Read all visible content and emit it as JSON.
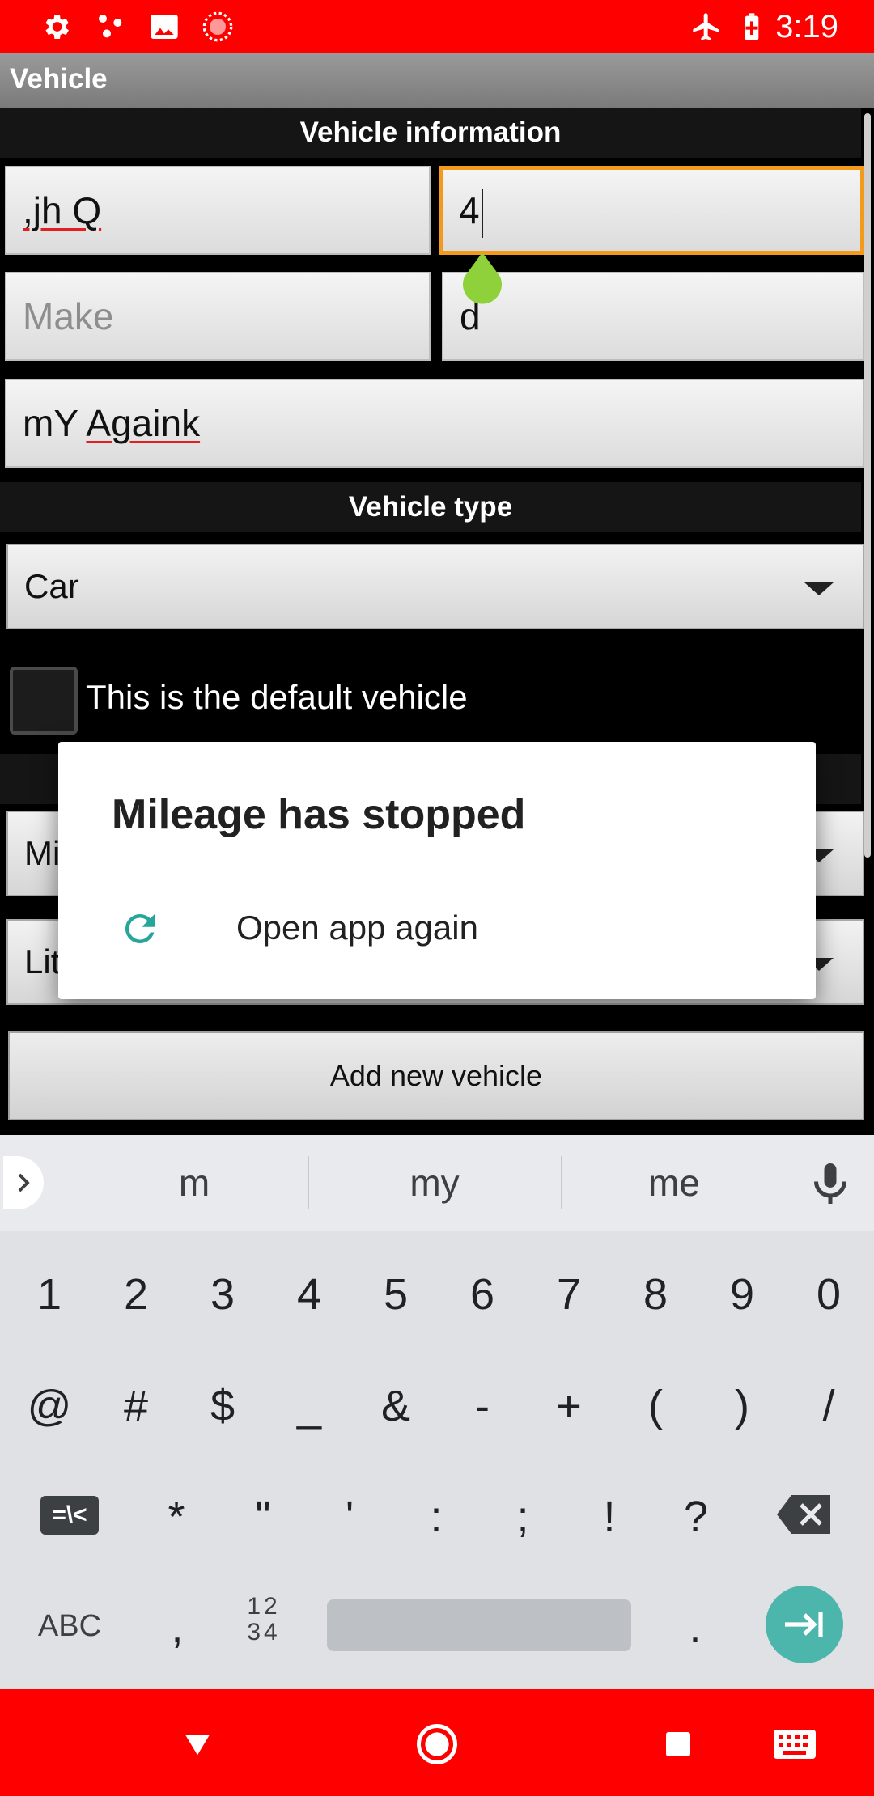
{
  "status_bar": {
    "time": "3:19",
    "icons": [
      "settings-icon",
      "network-dots-icon",
      "image-icon",
      "record-icon",
      "airplane-mode-icon",
      "battery-charging-icon"
    ]
  },
  "app": {
    "title": "Vehicle"
  },
  "vehicle_info": {
    "header": "Vehicle information",
    "name_value": ",jh Q",
    "year_value": "4",
    "make_placeholder": "Make",
    "model_value": "d",
    "note_value_prefix": "mY ",
    "note_value_underlined": "Againk"
  },
  "vehicle_type": {
    "header": "Vehicle type",
    "selected": "Car"
  },
  "default_checkbox": {
    "label": "This is the default vehicle",
    "checked": false
  },
  "units": {
    "distance_partial": "Mi",
    "volume_partial": "Lit"
  },
  "add_button_label": "Add new vehicle",
  "dialog": {
    "title": "Mileage has stopped",
    "action_label": "Open app again",
    "action_icon": "refresh-icon",
    "accent_color": "#26a69a"
  },
  "keyboard": {
    "suggestions": [
      "m",
      "my",
      "me"
    ],
    "row1": [
      "1",
      "2",
      "3",
      "4",
      "5",
      "6",
      "7",
      "8",
      "9",
      "0"
    ],
    "row2": [
      "@",
      "#",
      "$",
      "_",
      "&",
      "-",
      "+",
      "(",
      ")",
      "/"
    ],
    "row3": [
      "*",
      "\"",
      "'",
      ":",
      ";",
      "!",
      "?"
    ],
    "symbols_toggle": "=\\<",
    "abc_label": "ABC",
    "comma": ",",
    "numpad_label_top": "12",
    "numpad_label_bottom": "34",
    "period": "."
  },
  "colors": {
    "status_bar": "#ff0000",
    "focus_border": "#f39a1c",
    "enter_key": "#4db6ac"
  }
}
